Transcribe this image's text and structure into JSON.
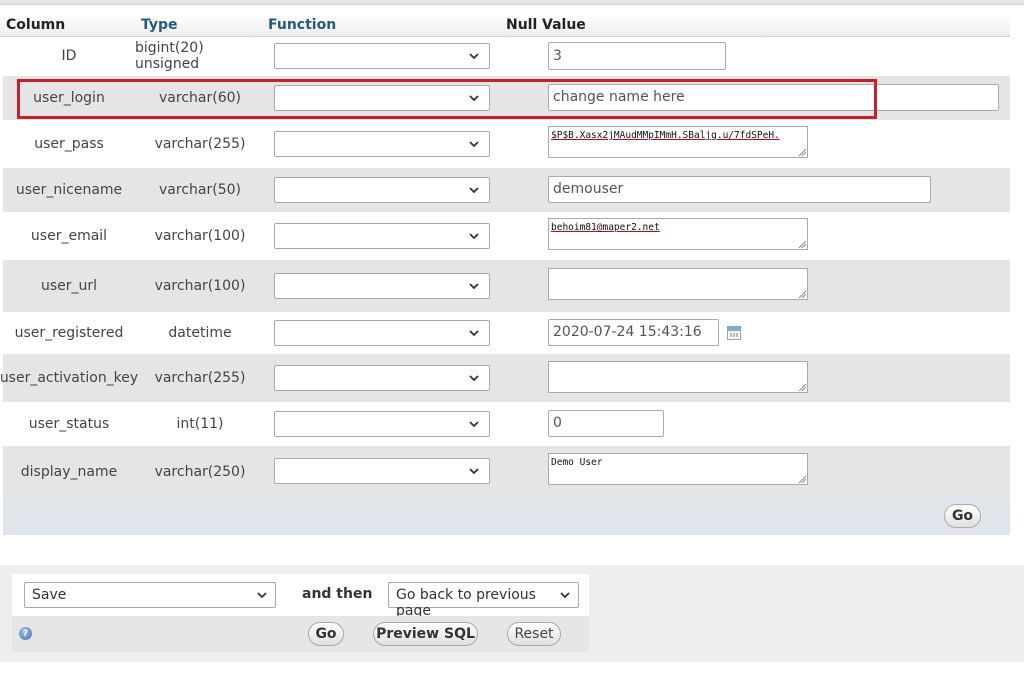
{
  "header": {
    "column": "Column",
    "type": "Type",
    "function": "Function",
    "null": "Null",
    "value": "Value"
  },
  "rows": [
    {
      "column": "ID",
      "type": "bigint(20) unsigned",
      "value": "3"
    },
    {
      "column": "user_login",
      "type": "varchar(60)",
      "value": "change name here"
    },
    {
      "column": "user_pass",
      "type": "varchar(255)",
      "value": "$P$B.Xasx2jMAudMMpIMmH.SBaljg.u/7fdSPeH."
    },
    {
      "column": "user_nicename",
      "type": "varchar(50)",
      "value": "demouser"
    },
    {
      "column": "user_email",
      "type": "varchar(100)",
      "value": "behoim81@maper2.net"
    },
    {
      "column": "user_url",
      "type": "varchar(100)",
      "value": ""
    },
    {
      "column": "user_registered",
      "type": "datetime",
      "value": "2020-07-24 15:43:16"
    },
    {
      "column": "user_activation_key",
      "type": "varchar(255)",
      "value": ""
    },
    {
      "column": "user_status",
      "type": "int(11)",
      "value": "0"
    },
    {
      "column": "display_name",
      "type": "varchar(250)",
      "value": "Demo User"
    }
  ],
  "icons": {
    "dropdown": "chevron-down-icon",
    "calendar": "calendar-icon",
    "help": "help-icon"
  },
  "go_label": "Go",
  "bottom": {
    "action_select": "Save",
    "and_then": "and then",
    "after_select": "Go back to previous page",
    "go_label": "Go",
    "preview_label": "Preview SQL",
    "reset_label": "Reset"
  },
  "colors": {
    "highlight_border": "#c8202a",
    "header_link": "#235a81",
    "row_alt": "#e5e5e5"
  }
}
